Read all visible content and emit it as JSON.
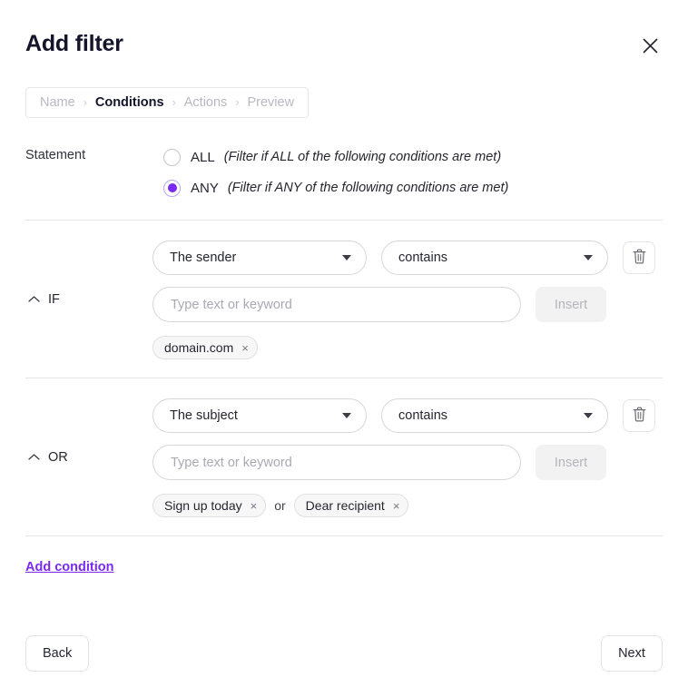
{
  "header": {
    "title": "Add filter",
    "close_icon": "close-icon"
  },
  "breadcrumb": {
    "separator": "›",
    "steps": [
      {
        "label": "Name",
        "active": false
      },
      {
        "label": "Conditions",
        "active": true
      },
      {
        "label": "Actions",
        "active": false
      },
      {
        "label": "Preview",
        "active": false
      }
    ]
  },
  "statement": {
    "label": "Statement",
    "options": [
      {
        "name": "ALL",
        "hint": "(Filter if ALL of the following conditions are met)",
        "selected": false
      },
      {
        "name": "ANY",
        "hint": "(Filter if ANY of the following conditions are met)",
        "selected": true
      }
    ]
  },
  "conditions": [
    {
      "keyword": "IF",
      "collapse_icon": "chevron-up-icon",
      "field": "The sender",
      "operator": "contains",
      "delete_icon": "trash-icon",
      "input_value": "",
      "input_placeholder": "Type text or keyword",
      "insert_label": "Insert",
      "tags": [
        {
          "label": "domain.com",
          "remove": "×"
        }
      ],
      "tag_joiner": ""
    },
    {
      "keyword": "OR",
      "collapse_icon": "chevron-up-icon",
      "field": "The subject",
      "operator": "contains",
      "delete_icon": "trash-icon",
      "input_value": "",
      "input_placeholder": "Type text or keyword",
      "insert_label": "Insert",
      "tags": [
        {
          "label": "Sign up today",
          "remove": "×"
        },
        {
          "label": "Dear recipient",
          "remove": "×"
        }
      ],
      "tag_joiner": "or"
    }
  ],
  "add_condition_label": "Add condition",
  "footer": {
    "back_label": "Back",
    "next_label": "Next"
  },
  "colors": {
    "accent_purple": "#7b29f0",
    "border_gray": "#d6d6db",
    "divider_gray": "#e4e4e7",
    "muted_text": "#b9b9c0",
    "disabled_bg": "#f2f2f3"
  }
}
